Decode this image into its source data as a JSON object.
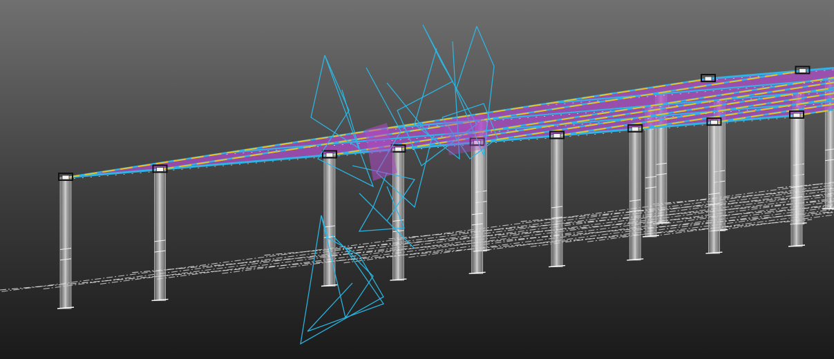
{
  "viewport": {
    "view": "3d-model",
    "background_top": "#707070",
    "background_bottom": "#1a1a1a"
  },
  "model": {
    "element_types": [
      "column",
      "beam",
      "slab",
      "grid-line",
      "deformed-shape"
    ],
    "colors": {
      "slab": "#b04cc8",
      "beam": "#2fb4e6",
      "support_line": "#f0c419",
      "column": "#d9d9d9",
      "grid_line": "#e8e8e8",
      "deformed_shape": "#2ab8e8",
      "column_cap": "#111111"
    }
  }
}
